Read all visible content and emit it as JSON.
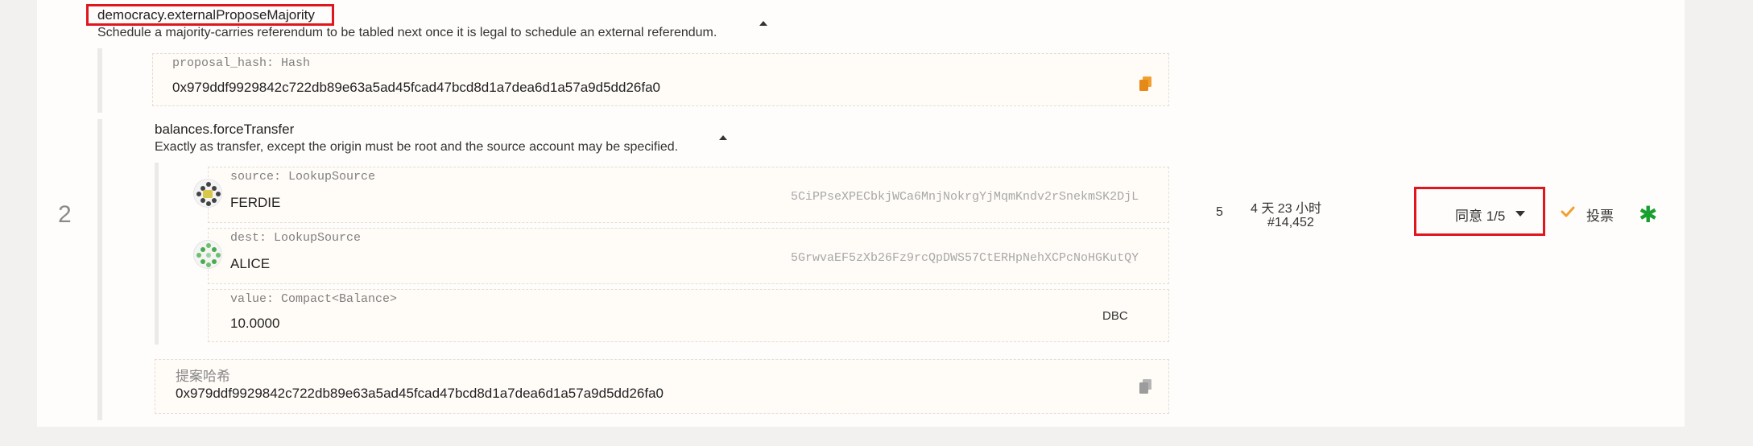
{
  "proposal": {
    "index": "2",
    "call": {
      "name": "democracy.externalProposeMajority",
      "description": "Schedule a majority-carries referendum to be tabled next once it is legal to schedule an external referendum.",
      "params": {
        "proposal_hash_label": "proposal_hash: Hash",
        "proposal_hash_value": "0x979ddf9929842c722db89e63a5ad45fcad47bcd8d1a7dea6d1a57a9d5dd26fa0"
      }
    },
    "inner_call": {
      "name": "balances.forceTransfer",
      "description": "Exactly as transfer, except the origin must be root and the source account may be specified.",
      "source": {
        "label": "source: LookupSource",
        "name": "FERDIE",
        "address": "5CiPPseXPECbkjWCa6MnjNokrgYjMqmKndv2rSnekmSK2DjL"
      },
      "dest": {
        "label": "dest: LookupSource",
        "name": "ALICE",
        "address": "5GrwvaEF5zXb26Fz9rcQpDWS57CtERHpNehXCPcNoHGKutQY"
      },
      "value": {
        "label": "value: Compact<Balance>",
        "amount": "10.0000",
        "unit": "DBC"
      }
    },
    "hash_section": {
      "label": "提案哈希",
      "value": "0x979ddf9929842c722db89e63a5ad45fcad47bcd8d1a7dea6d1a57a9d5dd26fa0"
    },
    "threshold": "5",
    "time_remaining": "4 天 23 小时",
    "block": "#14,452",
    "votes_dropdown": "同意 1/5",
    "vote_button": "投票",
    "colors": {
      "highlight": "#e0161e",
      "vote_check": "#f0a030",
      "asterisk": "#17a02f"
    },
    "icons": [
      "copy-icon",
      "copy-icon",
      "check-icon",
      "asterisk-icon",
      "caret-up-icon",
      "caret-down-icon"
    ]
  }
}
